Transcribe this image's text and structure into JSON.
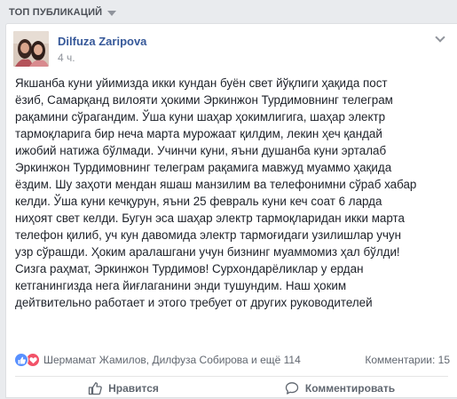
{
  "feed_header": {
    "label": "ТОП ПУБЛИКАЦИЙ"
  },
  "post": {
    "author": "Dilfuza Zaripova",
    "timestamp": "4 ч.",
    "text": "Якшанба куни уйимизда икки кундан буён свет йўқлиги ҳақида пост\nёзиб, Самарқанд вилояти ҳокими Эркинжон Турдимовнинг телеграм\nрақамини сўрагандим. Ўша куни шаҳар ҳокимлигига, шаҳар электр\nтармоқларига бир неча марта мурожаат қилдим, лекин ҳеч қандай\nижобий натижа бўлмади. Учинчи куни, яъни душанба куни эрталаб\nЭркинжон Турдимовнинг телеграм рақамига мавжуд муаммо ҳақида\nёздим. Шу заҳоти мендан яшаш манзилим ва телефонимни сўраб хабар\nкелди. Ўша куни кечқурун, яъни 25 февраль куни кеч соат 6 ларда\nниҳоят свет келди. Бугун эса шаҳар электр тармоқларидан икки марта\nтелефон қилиб, уч кун давомида электр тармоғидаги узилишлар учун\nузр сўрашди. Ҳоким аралашгани учун бизнинг муаммомиз ҳал бўлди!\nСизга раҳмат, Эркинжон Турдимов! Сурхондарёликлар у ердан\nкетганингизда нега йиғлаганини энди тушундим. Наш ҳоким\nдейтвительно работает и этого требует от других руководителей",
    "reactions": {
      "summary": "Шермамат Жамилов, Дилфуза Собирова и ещё 114",
      "comments": "Комментарии: 15"
    },
    "actions": {
      "like": "Нравится",
      "comment": "Комментировать"
    }
  },
  "colors": {
    "link": "#365899",
    "like_react": "#5890ff",
    "love_react": "#f25268",
    "background": "#e9ebee"
  },
  "icons": [
    "caret-down-icon",
    "chevron-down-icon",
    "like-reaction-icon",
    "love-reaction-icon",
    "thumbs-up-icon",
    "comment-bubble-icon"
  ]
}
